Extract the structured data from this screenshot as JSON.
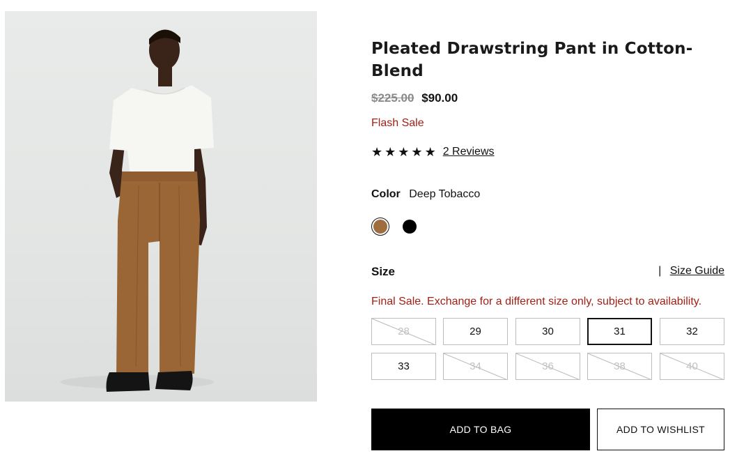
{
  "product": {
    "title": "Pleated Drawstring Pant in Cotton-Blend",
    "price_original": "$225.00",
    "price_sale": "$90.00",
    "sale_label": "Flash Sale",
    "rating_stars": 5,
    "reviews_label": "2 Reviews"
  },
  "color": {
    "label": "Color",
    "selected_name": "Deep Tobacco",
    "swatches": [
      {
        "name": "Deep Tobacco",
        "hex": "#a06d3f",
        "selected": true
      },
      {
        "name": "Black",
        "hex": "#000000",
        "selected": false
      }
    ]
  },
  "size": {
    "label": "Size",
    "guide_label": "Size Guide",
    "notice": "Final Sale. Exchange for a different size only, subject to availability.",
    "options": [
      {
        "label": "28",
        "available": false,
        "selected": false
      },
      {
        "label": "29",
        "available": true,
        "selected": false
      },
      {
        "label": "30",
        "available": true,
        "selected": false
      },
      {
        "label": "31",
        "available": true,
        "selected": true
      },
      {
        "label": "32",
        "available": true,
        "selected": false
      },
      {
        "label": "33",
        "available": true,
        "selected": false
      },
      {
        "label": "34",
        "available": false,
        "selected": false
      },
      {
        "label": "36",
        "available": false,
        "selected": false
      },
      {
        "label": "38",
        "available": false,
        "selected": false
      },
      {
        "label": "40",
        "available": false,
        "selected": false
      }
    ]
  },
  "actions": {
    "add_to_bag": "ADD TO BAG",
    "add_to_wishlist": "ADD TO WISHLIST"
  },
  "colors": {
    "sale_red": "#a32016",
    "primary_black": "#000000"
  }
}
